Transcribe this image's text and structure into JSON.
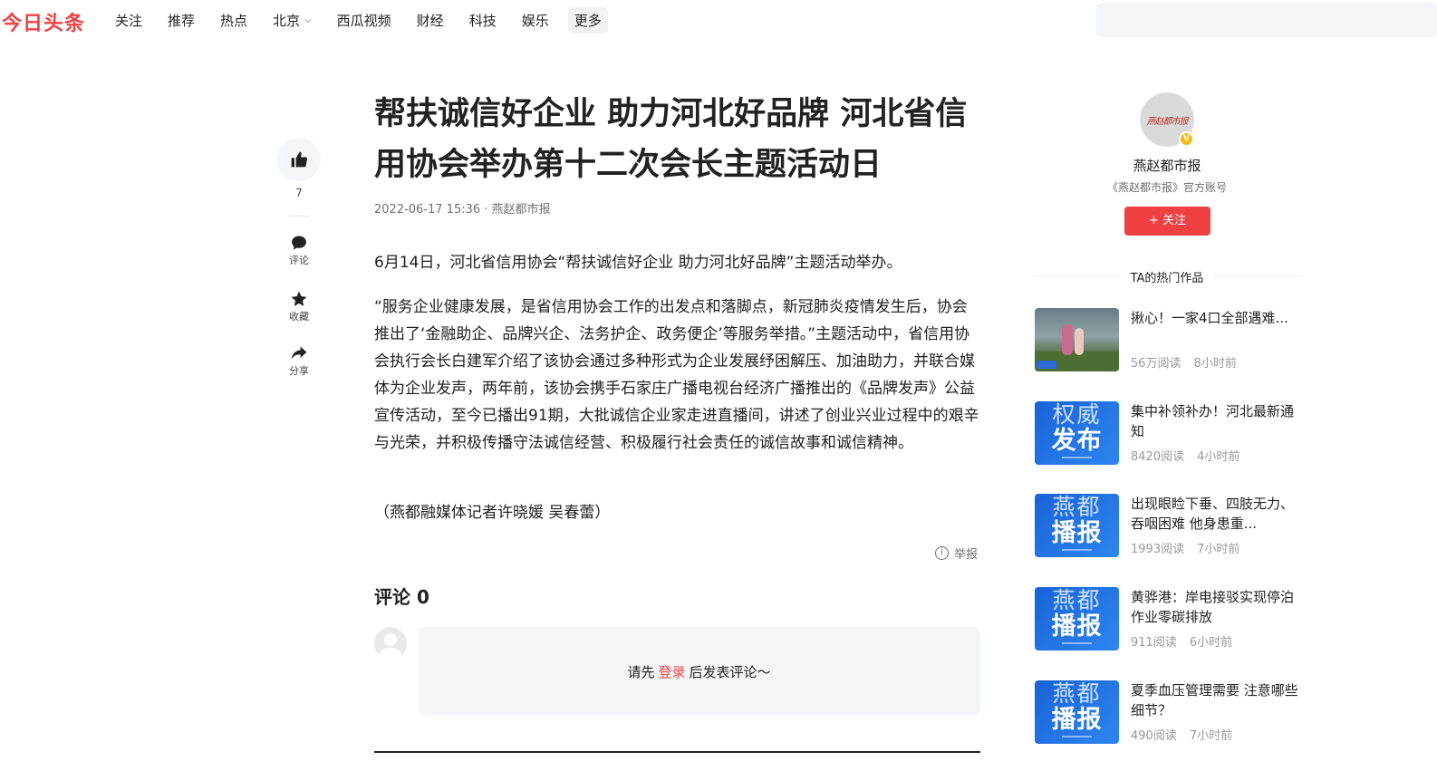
{
  "header": {
    "logo": "今日头条",
    "nav": [
      "关注",
      "推荐",
      "热点",
      "北京",
      "西瓜视频",
      "财经",
      "科技",
      "娱乐",
      "更多"
    ]
  },
  "toolbar": {
    "like_count": "7",
    "comment_label": "评论",
    "collect_label": "收藏",
    "share_label": "分享"
  },
  "article": {
    "title": "帮扶诚信好企业 助力河北好品牌 河北省信用协会举办第十二次会长主题活动日",
    "meta": "2022-06-17 15:36 · 燕赵都市报",
    "paragraphs": [
      "6月14日，河北省信用协会“帮扶诚信好企业 助力河北好品牌”主题活动举办。",
      "“服务企业健康发展，是省信用协会工作的出发点和落脚点，新冠肺炎疫情发生后，协会推出了‘金融助企、品牌兴企、法务护企、政务便企’等服务举措。”主题活动中，省信用协会执行会长白建军介绍了该协会通过多种形式为企业发展纾困解压、加油助力，并联合媒体为企业发声，两年前，该协会携手石家庄广播电视台经济广播推出的《品牌发声》公益宣传活动，至今已播出91期，大批诚信企业家走进直播间，讲述了创业兴业过程中的艰辛与光荣，并积极传播守法诚信经营、积极履行社会责任的诚信故事和诚信精神。",
      "（燕都融媒体记者许晓媛 吴春蕾）"
    ],
    "report_label": "举报"
  },
  "comments": {
    "heading": "评论 0",
    "prompt_before": "请先",
    "login_link": "登录",
    "prompt_after": "后发表评论～"
  },
  "author": {
    "avatar_text": "燕赵都市报",
    "badge": "V",
    "name": "燕赵都市报",
    "desc": "《燕赵都市报》官方账号",
    "follow_label": "+ 关注",
    "hot_title": "TA的热门作品"
  },
  "works": [
    {
      "title": "揪心！一家4口全部遇难...",
      "reads": "56万阅读",
      "time": "8小时前",
      "thumb": "photo"
    },
    {
      "title": "集中补领补办！河北最新通知",
      "reads": "8420阅读",
      "time": "4小时前",
      "thumb": "blue",
      "t1": "权威",
      "t2": "发布"
    },
    {
      "title": "出现眼睑下垂、四肢无力、吞咽困难 他身患重...",
      "reads": "1993阅读",
      "time": "7小时前",
      "thumb": "blue",
      "t1": "燕都",
      "t2": "播报"
    },
    {
      "title": "黄骅港：岸电接驳实现停泊作业零碳排放",
      "reads": "911阅读",
      "time": "6小时前",
      "thumb": "blue",
      "t1": "燕都",
      "t2": "播报"
    },
    {
      "title": "夏季血压管理需要 注意哪些细节？",
      "reads": "490阅读",
      "time": "7小时前",
      "thumb": "blue",
      "t1": "燕都",
      "t2": "播报"
    }
  ],
  "colors": {
    "brand_red": "#f04142",
    "thumb_blue": "#1a63d8",
    "badge_gold": "#f5b91a"
  }
}
